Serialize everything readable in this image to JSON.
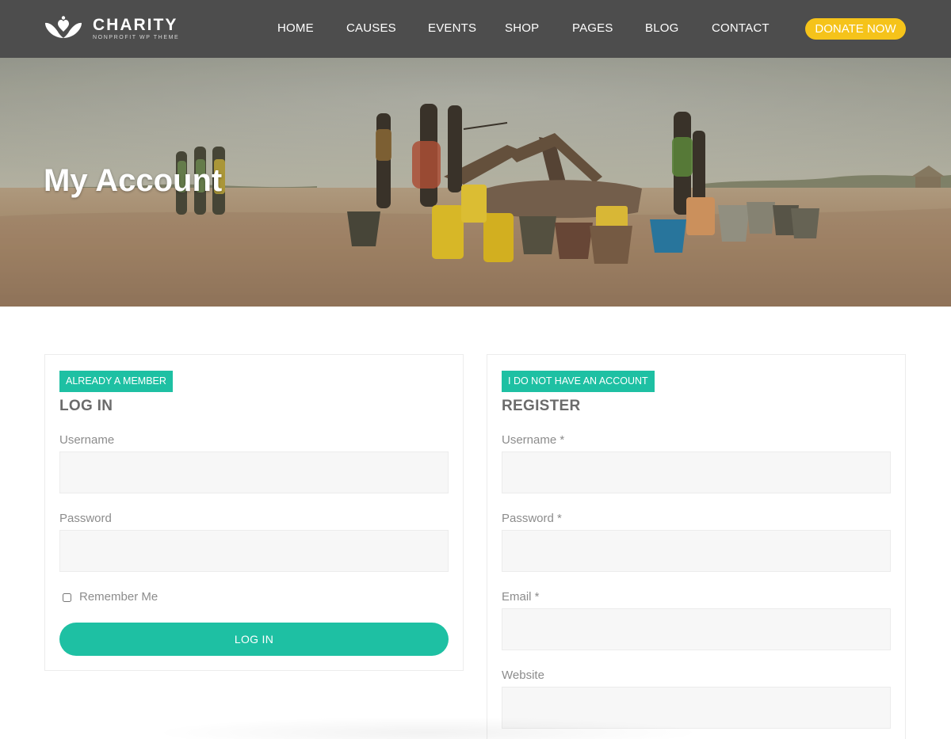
{
  "brand": {
    "title": "CHARITY",
    "subtitle": "NONPROFIT WP THEME",
    "logo_icon": "hands-heart-icon"
  },
  "nav": {
    "items": [
      {
        "label": "HOME"
      },
      {
        "label": "CAUSES"
      },
      {
        "label": "EVENTS"
      },
      {
        "label": "SHOP"
      },
      {
        "label": "PAGES"
      },
      {
        "label": "BLOG"
      },
      {
        "label": "CONTACT"
      }
    ],
    "donate_label": "DONATE NOW"
  },
  "hero": {
    "title": "My Account"
  },
  "login": {
    "tag": "ALREADY A MEMBER",
    "title": "LOG IN",
    "username_label": "Username",
    "password_label": "Password",
    "remember_label": "Remember Me",
    "submit_label": "LOG IN"
  },
  "register": {
    "tag": "I DO NOT HAVE AN ACCOUNT",
    "title": "REGISTER",
    "username_label": "Username *",
    "password_label": "Password *",
    "email_label": "Email *",
    "website_label": "Website"
  },
  "colors": {
    "header_bg": "#4d4d4d",
    "accent": "#1ec0a3",
    "donate": "#f5c31a"
  }
}
